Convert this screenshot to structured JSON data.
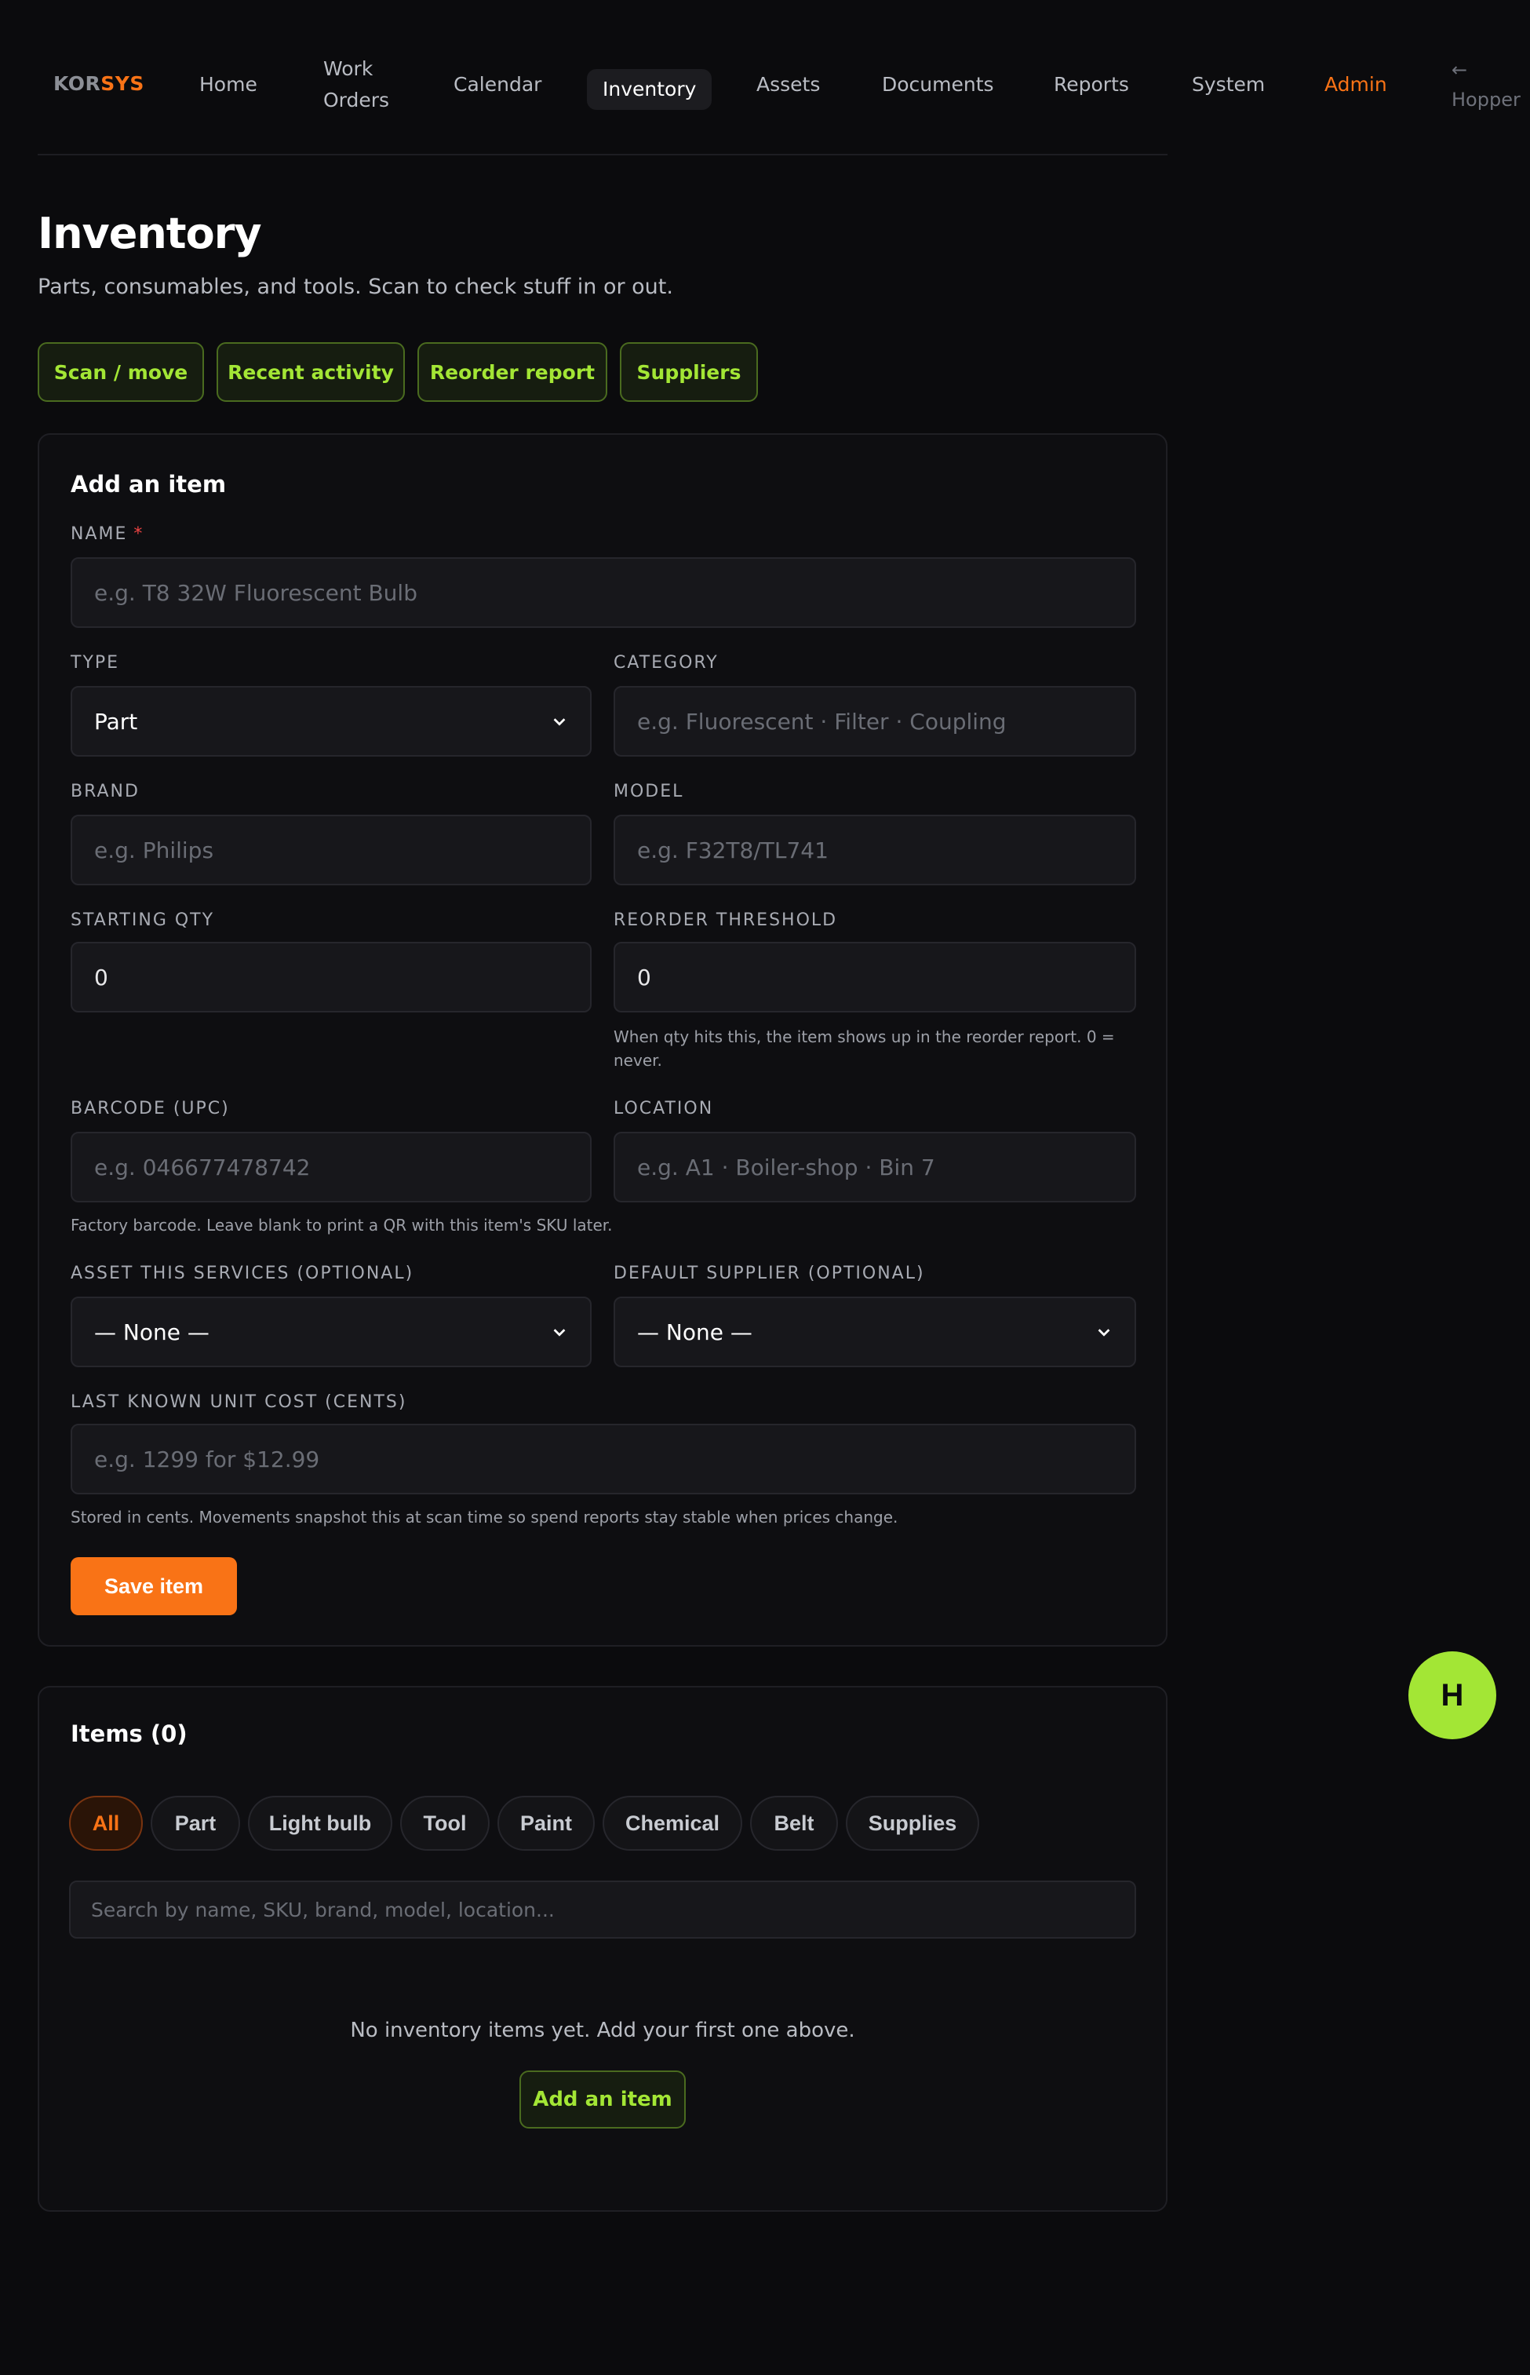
{
  "nav": {
    "logo_a": "KOR",
    "logo_b": "SYS",
    "items": [
      "Home",
      "Work",
      "Orders",
      "Calendar",
      "Inventory",
      "Assets",
      "Documents",
      "Reports",
      "System",
      "Admin"
    ],
    "user_arrow": "←",
    "user_name": "Hopper"
  },
  "page": {
    "title": "Inventory",
    "subtitle": "Parts, consumables, and tools. Scan to check stuff in or out."
  },
  "quick_actions": [
    "Scan / move",
    "Recent activity",
    "Reorder report",
    "Suppliers"
  ],
  "add_form": {
    "title": "Add an item",
    "name_label": "NAME",
    "required_mark": "*",
    "name_placeholder": "e.g. T8 32W Fluorescent Bulb",
    "type_label": "TYPE",
    "type_value": "Part",
    "category_label": "CATEGORY",
    "category_placeholder": "e.g. Fluorescent · Filter · Coupling",
    "brand_label": "BRAND",
    "brand_placeholder": "e.g. Philips",
    "model_label": "MODEL",
    "model_placeholder": "e.g. F32T8/TL741",
    "starting_qty_label": "STARTING QTY",
    "starting_qty_value": "0",
    "reorder_label": "REORDER THRESHOLD",
    "reorder_value": "0",
    "reorder_hint_1": "When qty hits this, the item shows up in the reorder report. 0 =",
    "reorder_hint_2": "never.",
    "barcode_label": "BARCODE (UPC)",
    "barcode_placeholder": "e.g. 046677478742",
    "barcode_hint": "Factory barcode. Leave blank to print a QR with this item's SKU later.",
    "location_label": "LOCATION",
    "location_placeholder": "e.g. A1 · Boiler-shop · Bin 7",
    "asset_label": "ASSET THIS SERVICES (OPTIONAL)",
    "asset_value": "— None —",
    "supplier_label": "DEFAULT SUPPLIER (OPTIONAL)",
    "supplier_value": "— None —",
    "cost_label": "LAST KNOWN UNIT COST (CENTS)",
    "cost_placeholder": "e.g. 1299 for $12.99",
    "cost_hint": "Stored in cents. Movements snapshot this at scan time so spend reports stay stable when prices change.",
    "save_label": "Save item"
  },
  "items_section": {
    "title": "Items (0)",
    "filters": [
      "All",
      "Part",
      "Light bulb",
      "Tool",
      "Paint",
      "Chemical",
      "Belt",
      "Supplies"
    ],
    "search_placeholder": "Search by name, SKU, brand, model, location...",
    "empty_message": "No inventory items yet. Add your first one above.",
    "add_label": "Add an item"
  },
  "fab": {
    "initial": "H"
  },
  "colors": {
    "accent_orange": "#f97316",
    "accent_green": "#a3e635",
    "background": "#0b0b0d"
  }
}
